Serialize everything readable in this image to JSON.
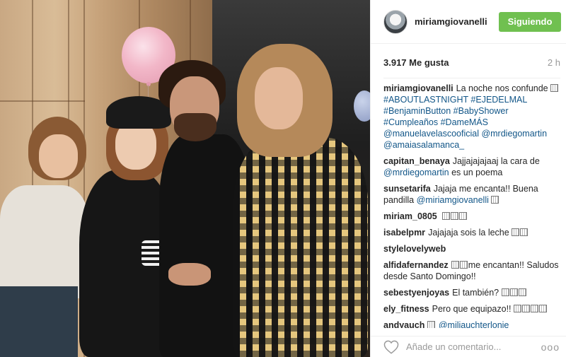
{
  "post": {
    "username": "miriamgiovanelli",
    "follow_label": "Siguiendo",
    "likes": "3.917 Me gusta",
    "time": "2 h"
  },
  "caption": {
    "username": "miriamgiovanelli",
    "text": "La noche nos confunde",
    "tags": "#ABOUTLASTNIGHT #EJEDELMAL #BenjaminButton #BabyShower #Cumpleaños #DameMÁS @manuelavelascooficial @mrdiegomartin @amaiasalamanca_"
  },
  "comments": [
    {
      "user": "capitan_benaya",
      "text": "Jajjajajajaaj la cara de",
      "tags": "@mrdiegomartin",
      "after": "es un poema"
    },
    {
      "user": "sunsetarifa",
      "text": "Jajaja me encanta!! Buena pandilla",
      "tags": "@miriamgiovanelli",
      "after": ""
    },
    {
      "user": "miriam_0805",
      "text": "",
      "tags": "",
      "after": ""
    },
    {
      "user": "isabelpmr",
      "text": "Jajajaja sois la leche",
      "tags": "",
      "after": ""
    },
    {
      "user": "stylelovelyweb",
      "text": "",
      "tags": "",
      "after": ""
    },
    {
      "user": "alfidafernandez",
      "text": "me encantan!! Saludos desde Santo Domingo!!",
      "tags": "",
      "after": ""
    },
    {
      "user": "sebestyenjoyas",
      "text": "El también?",
      "tags": "",
      "after": ""
    },
    {
      "user": "ely_fitness",
      "text": "Pero que equipazo!!",
      "tags": "",
      "after": ""
    },
    {
      "user": "andyauch",
      "text": "",
      "tags": "@miliauchterlonie",
      "after": ""
    }
  ],
  "footer": {
    "placeholder": "Añade un comentario...",
    "more": "ooo"
  },
  "icons": {
    "heart": "heart-icon",
    "more": "more-options-icon"
  },
  "colors": {
    "follow_button": "#70c050",
    "link": "#125688"
  }
}
